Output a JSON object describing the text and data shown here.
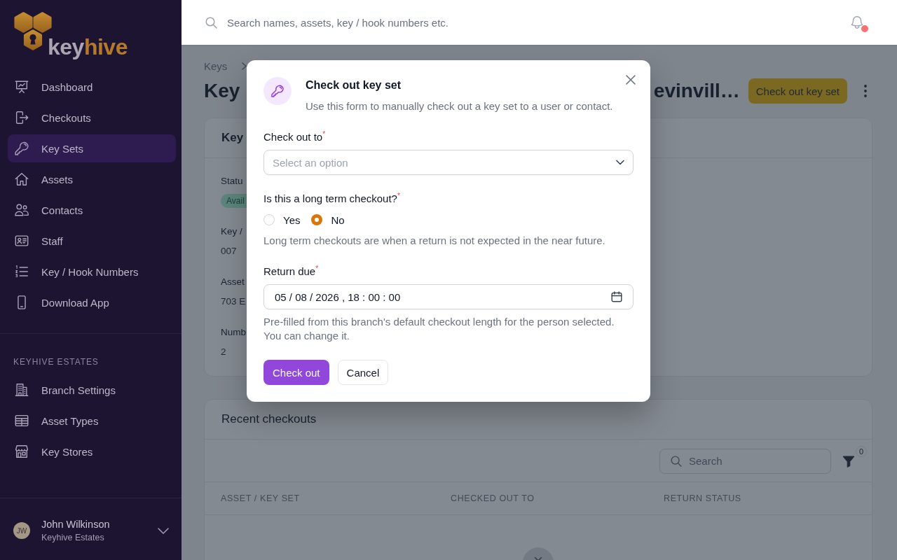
{
  "sidebar": {
    "logo": {
      "text_start": "key",
      "text_end": "hive"
    },
    "nav_items": [
      {
        "label": "Dashboard",
        "selected": false
      },
      {
        "label": "Checkouts",
        "selected": false
      },
      {
        "label": "Key Sets",
        "selected": true
      },
      {
        "label": "Assets",
        "selected": false
      },
      {
        "label": "Contacts",
        "selected": false
      },
      {
        "label": "Staff",
        "selected": false
      },
      {
        "label": "Key / Hook Numbers",
        "selected": false
      },
      {
        "label": "Download App",
        "selected": false
      }
    ],
    "section": {
      "title": "KEYHIVE ESTATES",
      "items": [
        {
          "label": "Branch Settings",
          "selected": false
        },
        {
          "label": "Asset Types",
          "selected": false
        },
        {
          "label": "Key Stores",
          "selected": false
        }
      ]
    },
    "user": {
      "initials": "JW",
      "name": "John Wilkinson",
      "organization": "Keyhive Estates"
    }
  },
  "top_bar": {
    "search": {
      "placeholder": "Search names, assets, key / hook numbers etc."
    },
    "notifications": {
      "unread": true
    }
  },
  "page_header": {
    "breadcrumbs": [
      {
        "label": "Keys"
      }
    ],
    "title_start": "Key",
    "title_end": "evinvill…",
    "action": {
      "label": "Check out key set"
    }
  },
  "details_card": {
    "title": "Key",
    "fields": [
      {
        "kind": "badge",
        "label": "Statu",
        "value": "Avail"
      },
      {
        "kind": "text",
        "label": "Key /",
        "value": "007"
      },
      {
        "kind": "text",
        "label": "Asset",
        "value": "703 E"
      },
      {
        "kind": "text",
        "label": "Numb",
        "value": "2"
      }
    ]
  },
  "recent_checkouts": {
    "title": "Recent checkouts",
    "search": {
      "placeholder": "Search"
    },
    "filter_count": "0",
    "table": {
      "columns": [
        "ASSET / KEY SET",
        "CHECKED OUT TO",
        "RETURN STATUS"
      ]
    }
  },
  "modal": {
    "title": "Check out key set",
    "description": "Use this form to manually check out a key set to a user or contact.",
    "fields": [
      {
        "kind": "select",
        "label": "Check out to$^{*}$",
        "placeholder": "Select an option"
      },
      {
        "kind": "radio",
        "label": "Is this a long term checkout?$^{*}$",
        "options": [
          {
            "label": "Yes",
            "selected": false
          },
          {
            "label": "No",
            "selected": true
          }
        ],
        "help": "Long term checkouts are when a return is not expected in the near future."
      },
      {
        "kind": "datetime",
        "label": "Return due$^{*}$",
        "value": "05 / 08 / 2026 , 18 : 00 : 00",
        "help": "Pre-filled from this branch's default checkout length for the person selected. You can change it."
      }
    ],
    "buttons": [
      {
        "kind": "primary",
        "label": "Check out"
      },
      {
        "kind": "secondary",
        "label": "Cancel"
      }
    ]
  }
}
